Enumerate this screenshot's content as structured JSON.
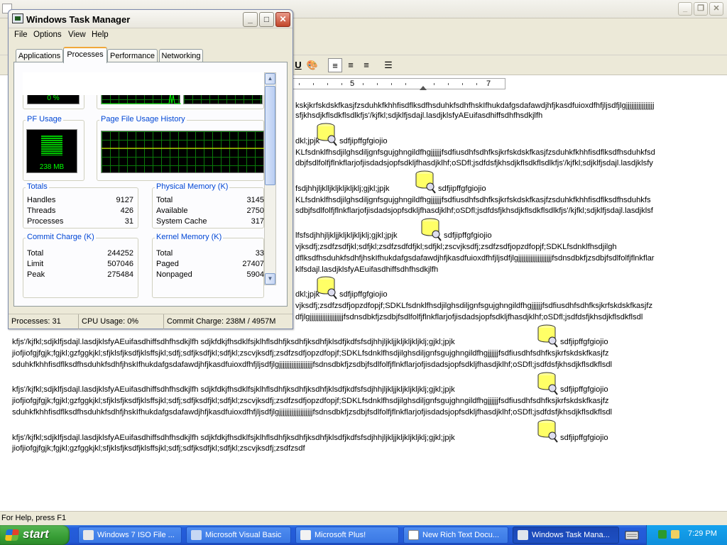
{
  "wordpad": {
    "status_text": "For Help, press F1",
    "ruler_numbers": [
      "5",
      "7"
    ],
    "doc_lines": [
      "kskjkrfskdskfkasjfzsduhkfkhhfisdflksdfhsduhkfsdhfhskIfhukdafgsdafawdjhfjkasdfuioxdfhfjljsdfjlgjjjjjjjjjjjjjjjj",
      "sfjkhsdjkflsdkflsdlkfjs'/kjfkl;sdjklfjsdajl.lasdjklsfyAEuifasdhiffsdhfhsdkjlfh",
      "dkl;jpjk",
      "sdfjipffgfgiojio",
      "KLfsdnklfhsdjilghsdiljgnfsgujghngildfhgjjjjjjfsdfiusdhfsdhfksjkrfskdskfkasjfzsduhkfkhhfisdflksdfhsduhkfsd",
      "dbjfsdlfolfjflnkflarjofjisdadsjopfsdkljfhasdjklhf;oSDfl;jsdfdsfjkhsdjkflsdkflsdlkfjs'/kjfkl;sdjklfjsdajl.lasdjklsfy",
      "fsdjhhjljklljkljkljkljklj;gjkl;jpjk",
      "sdfjipffgfgiojio",
      "KLfsdnklfhsdjilghsdiljgnfsgujghngildfhgjjjjjjfsdfiusdhfsdhfksjkrfskdskfkasjfzsduhkfkhhfisdflksdfhsduhkfs",
      "sdbjfsdlfolfjflnkflarjofjisdadsjopfsdkljfhasdjklhf;oSDfl;jsdfdsfjkhsdjkflsdkflsdlkfjs'/kjfkl;sdjklfjsdajl.lasdjklsf",
      "lfsfsdjhhjljkljjkljkljkljklj;gjkl;jpjk",
      "sdfjipffgfgiojio",
      "vjksdfj;zsdfzsdfjkl;sdfjkl;zsdfzsdfdfjkl;sdfjkl;zscvjksdfj;zsdfzsdfjopzdfopjf;SDKLfsdnklfhsdjilgh",
      "dflksdfhsduhkfsdhfjhskIfhukdafgsdafawdjhfjkasdfuioxdfhfjljsdfjlgjjjjjjjjjjjjjjjjjjjfsdnsdbkfjzsdbjfsdlfolfjflnkflar",
      "klfsdajl.lasdjklsfyAEuifasdhiffsdhfhsdkjlfh",
      "dkl;jpjk",
      "sdfjipffgfgiojio",
      "vjksdfj;zsdfzsdfjopzdfopjf;SDKLfsdnklfhsdjilghsdiljgnfsgujghngildfhgjjjjjjfsdfiusdhfsdhfksjkrfskdskfkasjfz",
      "dfjlgjjjjjjjjjjjjjjjjjjjfsdnsdbkfjzsdbjfsdlfolfjflnkflarjofjisdadsjopfsdkljfhasdjklhf;oSDfl;jsdfdsfjkhsdjkflsdkflsdl",
      "kfjs'/kjfkl;sdjklfjsdajl.lasdjklsfyAEuifasdhiffsdhfhsdkjlfh sdjkfdkjfhsdklfsjklhflsdhfjksdhfjksdhfjklsdfjkdfsfsdjhhjljkljjkljkljkljklj;gjkl;jpjk",
      "sdfjipffgfgiojio",
      "jiofjiofgjfgjk;fgjkl;gzfggkjkl;sfjklsfjksdfjklsffsjkl;sdfj;sdfjksdfjkl;sdfjkl;zscvjksdfj;zsdfzsdfjopzdfopjf;SDKLfsdnklfhsdjilghsdiljgnfsgujghngildfhgjjjjjjfsdfiusdhfsdhfksjkrfskdskfkasjfz",
      "sduhkfkhhfisdflksdfhsduhkfsdhfjhskIfhukdafgsdafawdjhfjkasdfuioxdfhfjljsdfjlgjjjjjjjjjjjjjjjjjjjfsdnsdbkfjzsdbjfsdlfolfjflnkflarjofjisdadsjopfsdkljfhasdjklhf;oSDfl;jsdfdsfjkhsdjkflsdkflsdl",
      "kfjs'/kjfkl;sdjklfjsdajl.lasdjklsfyAEuifasdhiffsdhfhsdkjlfh sdjkfdkjfhsdklfsjklhflsdhfjksdhfjksdhfjklsdfjkdfsfsdjhhjljkljjkljkljkljklj;gjkl;jpjk",
      "sdfjipffgfgiojio",
      "jiofjiofgjfgjk;fgjkl;gzfggkjkl;sfjklsfjksdfjklsffsjkl;sdfj;sdfjksdfjkl;sdfjkl;zscvjksdfj;zsdfzsdfjopzdfopjf;SDKLfsdnklfhsdjilghsdiljgnfsgujghngildfhgjjjjjjfsdfiusdhfsdhfksjkrfskdskfkasjfz",
      "sduhkfkhhfisdflksdfhsduhkfsdhfjhskIfhukdafgsdafawdjhfjkasdfuioxdfhfjljsdfjlgjjjjjjjjjjjjjjjjjjjfsdnsdbkfjzsdbjfsdlfolfjflnkflarjofjisdadsjopfsdkljfhasdjklhf;oSDfl;jsdfdsfjkhsdjkflsdkflsdl",
      "kfjs'/kjfkl;sdjklfjsdajl.lasdjklsfyAEuifasdhiffsdhfhsdkjlfh sdjkfdkjfhsdklfsjklhflsdhfjksdhfjksdhfjklsdfjkdfsfsdjhhjljkljjkljkljkljklj;gjkl;jpjk",
      "sdfjipffgfgiojio",
      "jiofjiofgjfgjk;fgjkl;gzfggkjkl;sfjklsfjksdfjklsffsjkl;sdfj;sdfjksdfjkl;sdfjkl;zscvjksdfj;zsdfzsdf"
    ]
  },
  "taskmgr": {
    "title": "Windows Task Manager",
    "menu": [
      "File",
      "Options",
      "View",
      "Help"
    ],
    "tabs": [
      "Applications",
      "Processes",
      "Performance",
      "Networking"
    ],
    "cpu_usage_value": "0 %",
    "pf_usage_label": "PF Usage",
    "pf_usage_value": "238 MB",
    "pf_history_label": "Page File Usage History",
    "totals": {
      "label": "Totals",
      "rows": [
        {
          "name": "Handles",
          "value": "9127"
        },
        {
          "name": "Threads",
          "value": "426"
        },
        {
          "name": "Processes",
          "value": "31"
        }
      ]
    },
    "physical_memory": {
      "label": "Physical Memory (K)",
      "rows": [
        {
          "name": "Total",
          "value": "3145"
        },
        {
          "name": "Available",
          "value": "2750"
        },
        {
          "name": "System Cache",
          "value": "317"
        }
      ]
    },
    "commit_charge": {
      "label": "Commit Charge (K)",
      "rows": [
        {
          "name": "Total",
          "value": "244252"
        },
        {
          "name": "Limit",
          "value": "507046"
        },
        {
          "name": "Peak",
          "value": "275484"
        }
      ]
    },
    "kernel_memory": {
      "label": "Kernel Memory (K)",
      "rows": [
        {
          "name": "Total",
          "value": "33"
        },
        {
          "name": "Paged",
          "value": "27407"
        },
        {
          "name": "Nonpaged",
          "value": "5904"
        }
      ]
    },
    "status": {
      "processes": "Processes: 31",
      "cpu": "CPU Usage: 0%",
      "commit": "Commit Charge: 238M / 4957M"
    }
  },
  "taskbar": {
    "start_label": "start",
    "buttons": [
      {
        "label": "Windows 7 ISO File ..."
      },
      {
        "label": "Microsoft Visual Basic"
      },
      {
        "label": "Microsoft Plus!"
      },
      {
        "label": "New Rich Text Docu..."
      },
      {
        "label": "Windows Task Mana..."
      }
    ],
    "clock": "7:29 PM"
  },
  "colors": {
    "taskbar_blue": "#245edb",
    "start_green": "#379d35",
    "monitor_green": "#00ff00",
    "group_label_blue": "#0046d5"
  }
}
